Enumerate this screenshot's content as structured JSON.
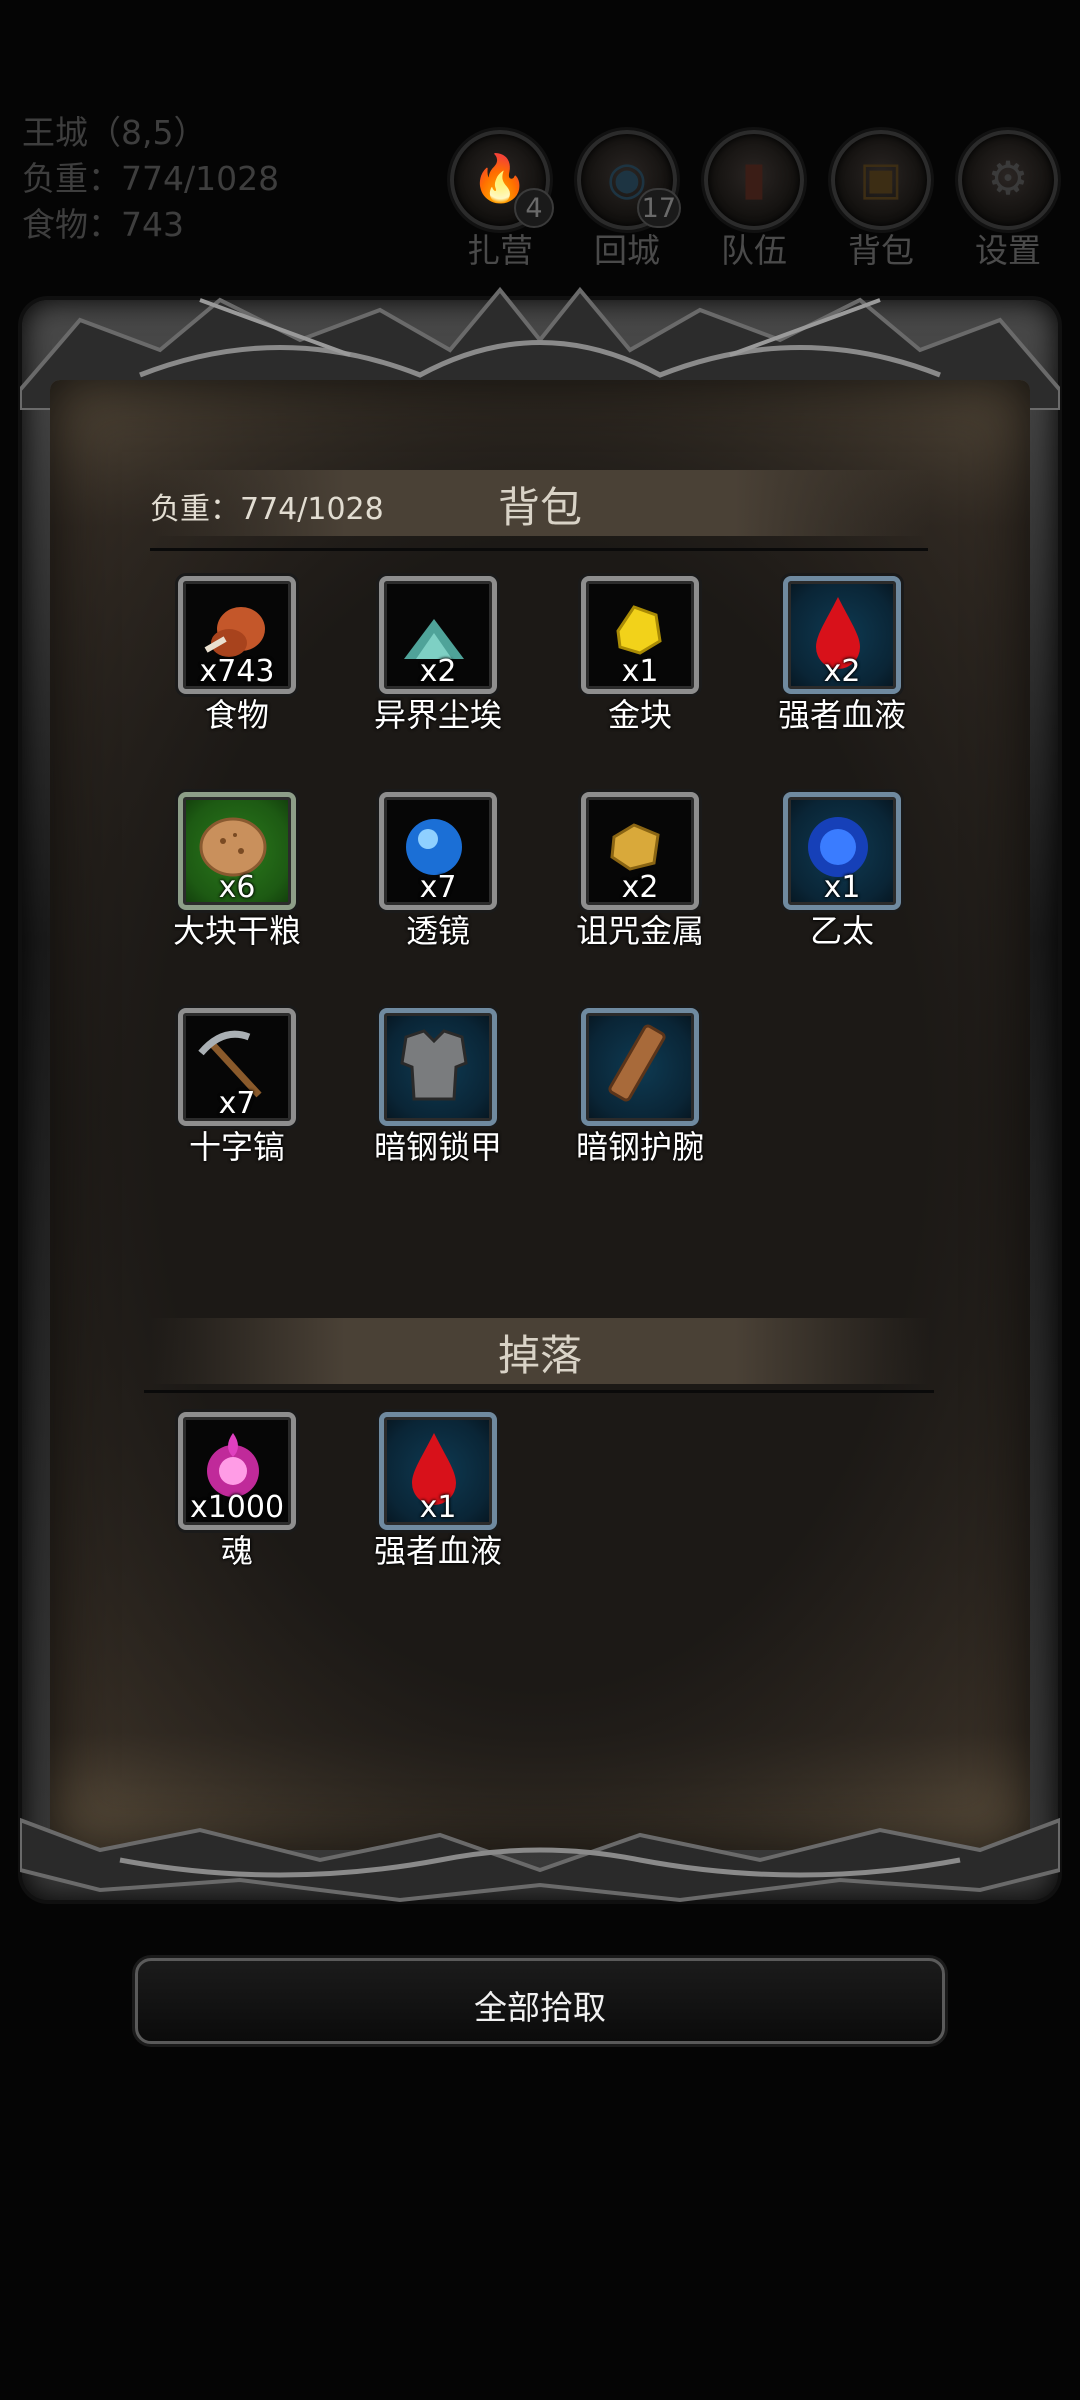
{
  "status": {
    "location": "王城（8,5）",
    "load": "负重：774/1028",
    "food": "食物：743"
  },
  "top_buttons": [
    {
      "label": "扎营",
      "badge": "4",
      "icon": "campfire-icon"
    },
    {
      "label": "回城",
      "badge": "17",
      "icon": "portal-icon"
    },
    {
      "label": "队伍",
      "badge": "",
      "icon": "team-icon"
    },
    {
      "label": "背包",
      "badge": "",
      "icon": "backpack-icon"
    },
    {
      "label": "设置",
      "badge": "",
      "icon": "gear-icon"
    }
  ],
  "backpack": {
    "title": "背包",
    "load": "负重：774/1028",
    "items": [
      {
        "name": "食物",
        "qty": "x743",
        "icon": "meat-icon",
        "bg": "dark"
      },
      {
        "name": "异界尘埃",
        "qty": "x2",
        "icon": "dust-icon",
        "bg": "dark"
      },
      {
        "name": "金块",
        "qty": "x1",
        "icon": "gold-nugget-icon",
        "bg": "dark"
      },
      {
        "name": "强者血液",
        "qty": "x2",
        "icon": "blood-drop-icon",
        "bg": "blue"
      },
      {
        "name": "大块干粮",
        "qty": "x6",
        "icon": "bread-icon",
        "bg": "green"
      },
      {
        "name": "透镜",
        "qty": "x7",
        "icon": "lens-orb-icon",
        "bg": "dark"
      },
      {
        "name": "诅咒金属",
        "qty": "x2",
        "icon": "cursed-metal-icon",
        "bg": "dark"
      },
      {
        "name": "乙太",
        "qty": "x1",
        "icon": "ether-icon",
        "bg": "blue"
      },
      {
        "name": "十字镐",
        "qty": "x7",
        "icon": "pickaxe-icon",
        "bg": "dark"
      },
      {
        "name": "暗钢锁甲",
        "qty": "",
        "icon": "chainmail-icon",
        "bg": "blue"
      },
      {
        "name": "暗钢护腕",
        "qty": "",
        "icon": "bracer-icon",
        "bg": "blue"
      }
    ]
  },
  "drops": {
    "title": "掉落",
    "items": [
      {
        "name": "魂",
        "qty": "x1000",
        "icon": "soul-icon",
        "bg": "dark"
      },
      {
        "name": "强者血液",
        "qty": "x1",
        "icon": "blood-drop-icon",
        "bg": "blue"
      }
    ]
  },
  "pick_all_label": "全部拾取",
  "colors": {
    "background": "#050505",
    "panel_fill": "#1c1916",
    "dim_text": "#3e3e3e",
    "rare_slot": "#0e3a52",
    "uncommon_slot": "#2b7a1c"
  }
}
